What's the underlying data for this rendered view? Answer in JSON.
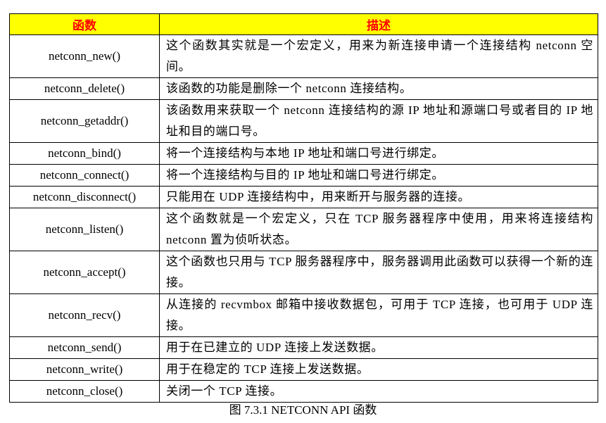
{
  "table": {
    "headers": {
      "function": "函数",
      "description": "描述"
    },
    "rows": [
      {
        "function": "netconn_new()",
        "description": "这个函数其实就是一个宏定义，用来为新连接申请一个连接结构 netconn 空间。"
      },
      {
        "function": "netconn_delete()",
        "description": "该函数的功能是删除一个 netconn 连接结构。"
      },
      {
        "function": "netconn_getaddr()",
        "description": "该函数用来获取一个 netconn 连接结构的源 IP 地址和源端口号或者目的 IP 地址和目的端口号。"
      },
      {
        "function": "netconn_bind()",
        "description": "将一个连接结构与本地 IP 地址和端口号进行绑定。"
      },
      {
        "function": "netconn_connect()",
        "description": "将一个连接结构与目的 IP 地址和端口号进行绑定。"
      },
      {
        "function": "netconn_disconnect()",
        "description": "只能用在 UDP 连接结构中，用来断开与服务器的连接。"
      },
      {
        "function": "netconn_listen()",
        "description": "这个函数就是一个宏定义，只在 TCP 服务器程序中使用，用来将连接结构 netconn 置为侦听状态。"
      },
      {
        "function": "netconn_accept()",
        "description": "这个函数也只用与 TCP 服务器程序中，服务器调用此函数可以获得一个新的连接。"
      },
      {
        "function": "netconn_recv()",
        "description": "从连接的 recvmbox 邮箱中接收数据包，可用于 TCP 连接，也可用于 UDP 连接。"
      },
      {
        "function": "netconn_send()",
        "description": "用于在已建立的 UDP 连接上发送数据。"
      },
      {
        "function": "netconn_write()",
        "description": "用于在稳定的 TCP 连接上发送数据。"
      },
      {
        "function": "netconn_close()",
        "description": "关闭一个 TCP 连接。"
      }
    ]
  },
  "caption": "图 7.3.1 NETCONN API 函数",
  "colors": {
    "header_bg": "#ffff00",
    "header_text": "#ff0000",
    "border": "#000000"
  }
}
